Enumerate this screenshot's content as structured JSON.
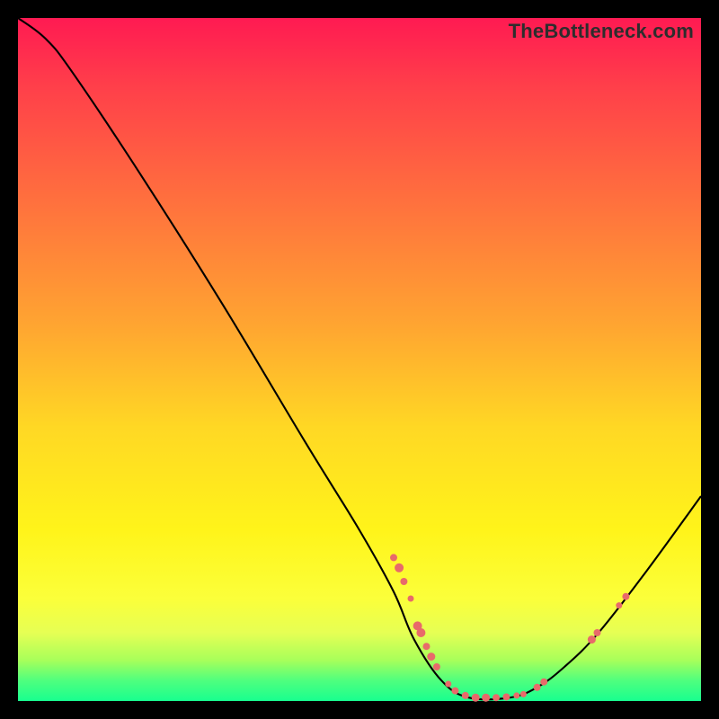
{
  "watermark": "TheBottleneck.com",
  "chart_data": {
    "type": "line",
    "title": "",
    "xlabel": "",
    "ylabel": "",
    "xlim": [
      0,
      100
    ],
    "ylim": [
      0,
      100
    ],
    "curve": [
      {
        "x": 0,
        "y": 100
      },
      {
        "x": 4,
        "y": 97
      },
      {
        "x": 8,
        "y": 92
      },
      {
        "x": 18,
        "y": 77
      },
      {
        "x": 30,
        "y": 58
      },
      {
        "x": 42,
        "y": 38
      },
      {
        "x": 50,
        "y": 25
      },
      {
        "x": 55,
        "y": 16
      },
      {
        "x": 58,
        "y": 9
      },
      {
        "x": 62,
        "y": 3
      },
      {
        "x": 66,
        "y": 0.5
      },
      {
        "x": 72,
        "y": 0.5
      },
      {
        "x": 76,
        "y": 2
      },
      {
        "x": 80,
        "y": 5
      },
      {
        "x": 85,
        "y": 10
      },
      {
        "x": 92,
        "y": 19
      },
      {
        "x": 100,
        "y": 30
      }
    ],
    "points": [
      {
        "x": 55.0,
        "y": 21.0,
        "r": 4
      },
      {
        "x": 55.8,
        "y": 19.5,
        "r": 5
      },
      {
        "x": 56.5,
        "y": 17.5,
        "r": 4
      },
      {
        "x": 57.5,
        "y": 15.0,
        "r": 3.5
      },
      {
        "x": 58.5,
        "y": 11.0,
        "r": 5
      },
      {
        "x": 59.0,
        "y": 10.0,
        "r": 5
      },
      {
        "x": 59.8,
        "y": 8.0,
        "r": 4
      },
      {
        "x": 60.5,
        "y": 6.5,
        "r": 4.5
      },
      {
        "x": 61.3,
        "y": 5.0,
        "r": 4
      },
      {
        "x": 63.0,
        "y": 2.5,
        "r": 3.5
      },
      {
        "x": 64.0,
        "y": 1.5,
        "r": 4
      },
      {
        "x": 65.5,
        "y": 0.8,
        "r": 4
      },
      {
        "x": 67.0,
        "y": 0.5,
        "r": 4.5
      },
      {
        "x": 68.5,
        "y": 0.5,
        "r": 4.5
      },
      {
        "x": 70.0,
        "y": 0.5,
        "r": 4
      },
      {
        "x": 71.5,
        "y": 0.6,
        "r": 4
      },
      {
        "x": 73.0,
        "y": 0.8,
        "r": 3.5
      },
      {
        "x": 74.0,
        "y": 1.0,
        "r": 3.5
      },
      {
        "x": 76.0,
        "y": 2.0,
        "r": 4
      },
      {
        "x": 77.0,
        "y": 2.8,
        "r": 4
      },
      {
        "x": 84.0,
        "y": 9.0,
        "r": 4.5
      },
      {
        "x": 84.8,
        "y": 10.0,
        "r": 4
      },
      {
        "x": 88.0,
        "y": 14.0,
        "r": 3.5
      },
      {
        "x": 89.0,
        "y": 15.3,
        "r": 4
      }
    ]
  }
}
